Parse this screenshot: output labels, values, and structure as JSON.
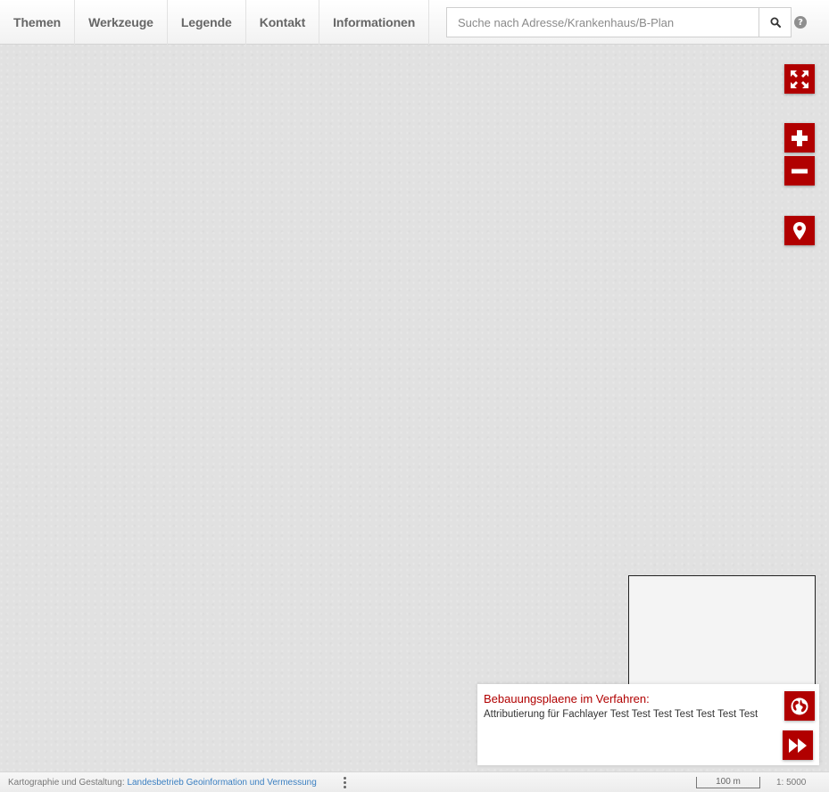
{
  "nav": {
    "items": [
      "Themen",
      "Werkzeuge",
      "Legende",
      "Kontakt",
      "Informationen"
    ]
  },
  "search": {
    "placeholder": "Suche nach Adresse/Krankenhaus/B-Plan",
    "button_icon": "search-icon"
  },
  "help": {
    "icon": "question-circle-icon",
    "glyph": "?"
  },
  "map_controls": {
    "fullscreen_icon": "expand-arrows-icon",
    "zoom_in_icon": "plus-icon",
    "zoom_out_icon": "minus-icon",
    "locate_icon": "map-marker-icon",
    "accent_color": "#b10000"
  },
  "attribution": {
    "title": "Bebauungsplaene im Verfahren:",
    "text": "Attributierung für Fachlayer Test Test Test Test Test Test Test",
    "globe_icon": "globe-icon",
    "collapse_icon": "fast-forward-icon"
  },
  "footer": {
    "credit_label": "Kartographie und Gestaltung:",
    "credit_link": "Landesbetrieb Geoinformation und Vermessung",
    "scale_bar": "100 m",
    "scale": "1: 5000"
  }
}
